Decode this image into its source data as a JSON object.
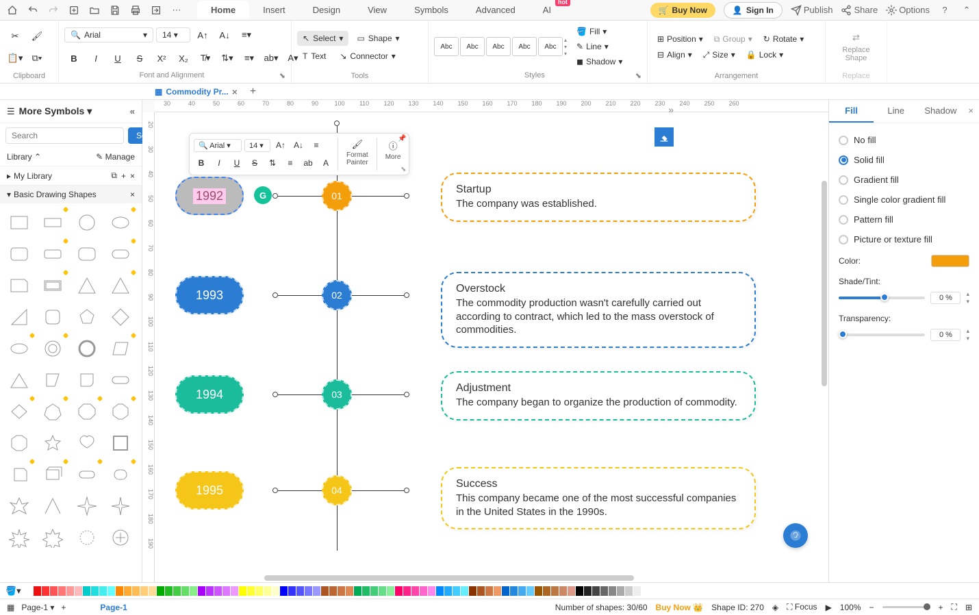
{
  "app": {
    "menu_tabs": [
      "Home",
      "Insert",
      "Design",
      "View",
      "Symbols",
      "Advanced",
      "AI"
    ],
    "active_tab": "Home",
    "hot_label": "hot",
    "buy_now": "Buy Now",
    "sign_in": "Sign In",
    "publish": "Publish",
    "share": "Share",
    "options": "Options"
  },
  "ribbon": {
    "clipboard_label": "Clipboard",
    "font_align_label": "Font and Alignment",
    "tools_label": "Tools",
    "styles_label": "Styles",
    "arrangement_label": "Arrangement",
    "replace_label": "Replace",
    "font_name": "Arial",
    "font_size": "14",
    "select": "Select",
    "shape": "Shape",
    "text": "Text",
    "connector": "Connector",
    "style_box": "Abc",
    "fill": "Fill",
    "line": "Line",
    "shadow": "Shadow",
    "position": "Position",
    "group": "Group",
    "rotate": "Rotate",
    "align": "Align",
    "size": "Size",
    "lock": "Lock",
    "replace_shape": "Replace\nShape"
  },
  "doc": {
    "tab_name": "Commodity Pr...",
    "add_tab": "+"
  },
  "left_panel": {
    "title": "More Symbols",
    "search_btn": "Search",
    "search_placeholder": "Search",
    "library": "Library",
    "manage": "Manage",
    "my_library": "My Library",
    "basic_shapes": "Basic Drawing Shapes"
  },
  "ruler_h": [
    "30",
    "40",
    "50",
    "60",
    "70",
    "80",
    "90",
    "100",
    "110",
    "120",
    "130",
    "140",
    "150",
    "160",
    "170",
    "180",
    "190",
    "200",
    "210",
    "220",
    "230",
    "240",
    "250",
    "260"
  ],
  "ruler_v": [
    "20",
    "30",
    "40",
    "50",
    "60",
    "70",
    "80",
    "90",
    "100",
    "110",
    "120",
    "130",
    "140",
    "150",
    "160",
    "170",
    "180",
    "190"
  ],
  "mini_tb": {
    "font": "Arial",
    "size": "14",
    "format_painter": "Format\nPainter",
    "more": "More"
  },
  "timeline": {
    "items": [
      {
        "year": "1992",
        "num": "01",
        "title": "Startup",
        "text": "The company was established.",
        "color": "#f59e0b",
        "year_color": "#9ca3af",
        "year_text_color": "#a04b6b"
      },
      {
        "year": "1993",
        "num": "02",
        "title": "Overstock",
        "text": "The commodity production wasn't carefully carried out according to contract, which led to the mass overstock of commodities.",
        "color": "#2b7cd3",
        "year_color": "#2b7cd3"
      },
      {
        "year": "1994",
        "num": "03",
        "title": "Adjustment",
        "text": "The company began to organize the production of commodity.",
        "color": "#1abc9c",
        "year_color": "#1abc9c"
      },
      {
        "year": "1995",
        "num": "04",
        "title": "Success",
        "text": "This company became one of the most successful companies in the United States in the 1990s.",
        "color": "#f5c518",
        "year_color": "#f5c518"
      }
    ]
  },
  "right_panel": {
    "tabs": [
      "Fill",
      "Line",
      "Shadow"
    ],
    "active_tab": "Fill",
    "options": [
      "No fill",
      "Solid fill",
      "Gradient fill",
      "Single color gradient fill",
      "Pattern fill",
      "Picture or texture fill"
    ],
    "selected": "Solid fill",
    "color_label": "Color:",
    "color_value": "#f59e0b",
    "shade_label": "Shade/Tint:",
    "shade_value": "0 %",
    "transparency_label": "Transparency:",
    "transparency_value": "0 %"
  },
  "status": {
    "page_tab": "Page-1",
    "page_current": "Page-1",
    "shapes_count": "Number of shapes: 30/60",
    "buy_now": "Buy Now",
    "shape_id": "Shape ID: 270",
    "focus": "Focus",
    "zoom": "100%"
  },
  "color_bar": [
    "#fff",
    "#e11",
    "#f33",
    "#f55",
    "#f77",
    "#f99",
    "#fbb",
    "#0cc",
    "#2dd",
    "#4ee",
    "#6ff",
    "#f80",
    "#fa3",
    "#fb5",
    "#fc7",
    "#fd9",
    "#0a0",
    "#2b2",
    "#4c4",
    "#6d6",
    "#8e8",
    "#a0f",
    "#b3f",
    "#c5f",
    "#d7f",
    "#e9f",
    "#ff0",
    "#ff3",
    "#ff6",
    "#ff9",
    "#ffc",
    "#00f",
    "#33f",
    "#55f",
    "#77f",
    "#99f",
    "#a52",
    "#b63",
    "#c74",
    "#d85",
    "#0a5",
    "#2b6",
    "#4c7",
    "#6d8",
    "#8e9",
    "#f06",
    "#f28",
    "#f4a",
    "#f6c",
    "#f8e",
    "#08f",
    "#2af",
    "#4cf",
    "#6ef",
    "#830",
    "#a52",
    "#c74",
    "#e96",
    "#06c",
    "#28d",
    "#4ae",
    "#6cf",
    "#950",
    "#a62",
    "#b74",
    "#c86",
    "#d98",
    "#000",
    "#222",
    "#444",
    "#666",
    "#888",
    "#aaa",
    "#ccc",
    "#eee"
  ]
}
